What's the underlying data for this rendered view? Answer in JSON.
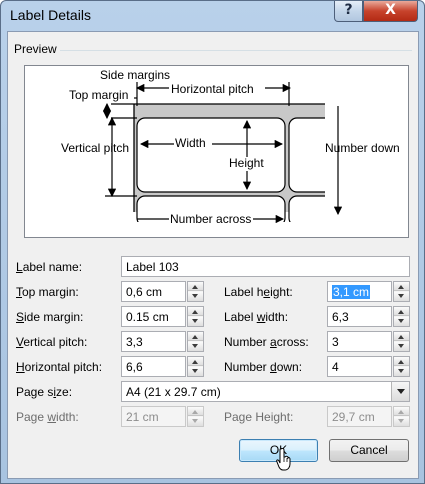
{
  "window": {
    "title": "Label Details",
    "help_glyph": "?",
    "close_glyph": "X"
  },
  "preview": {
    "group_label": "Preview",
    "labels": {
      "side_margins": "Side margins",
      "top_margin": "Top margin",
      "horizontal_pitch": "Horizontal pitch",
      "vertical_pitch": "Vertical pitch",
      "width": "Width",
      "height": "Height",
      "number_down": "Number down",
      "number_across": "Number across"
    }
  },
  "form": {
    "label_name": {
      "label_pre": "",
      "label_u": "L",
      "label_post": "abel name:",
      "value": "Label 103"
    },
    "top_margin": {
      "label_u": "T",
      "label_post": "op margin:",
      "value": "0,6 cm"
    },
    "side_margin": {
      "label_u": "S",
      "label_post": "ide margin:",
      "value": "0.15 cm"
    },
    "vertical_pitch": {
      "label_u": "V",
      "label_post": "ertical pitch:",
      "value": "3,3"
    },
    "horizontal_pitch": {
      "label_u": "H",
      "label_post": "orizontal pitch:",
      "value": "6,6"
    },
    "label_height": {
      "label_pre": "Label h",
      "label_u": "e",
      "label_post": "ight:",
      "value": "3,1 cm"
    },
    "label_width": {
      "label_pre": "Label ",
      "label_u": "w",
      "label_post": "idth:",
      "value": "6,3"
    },
    "number_across": {
      "label_pre": "Number ",
      "label_u": "a",
      "label_post": "cross:",
      "value": "3"
    },
    "number_down": {
      "label_pre": "Number ",
      "label_u": "d",
      "label_post": "own:",
      "value": "4"
    },
    "page_size": {
      "label_pre": "Page s",
      "label_u": "i",
      "label_post": "ze:",
      "value": "A4 (21 x 29.7 cm)"
    },
    "page_width": {
      "label_pre": "Page ",
      "label_u": "w",
      "label_post": "idth:",
      "value": "21 cm"
    },
    "page_height": {
      "label_pre": "Page Height:",
      "value": "29,7 cm"
    }
  },
  "buttons": {
    "ok": "OK",
    "cancel": "Cancel"
  }
}
